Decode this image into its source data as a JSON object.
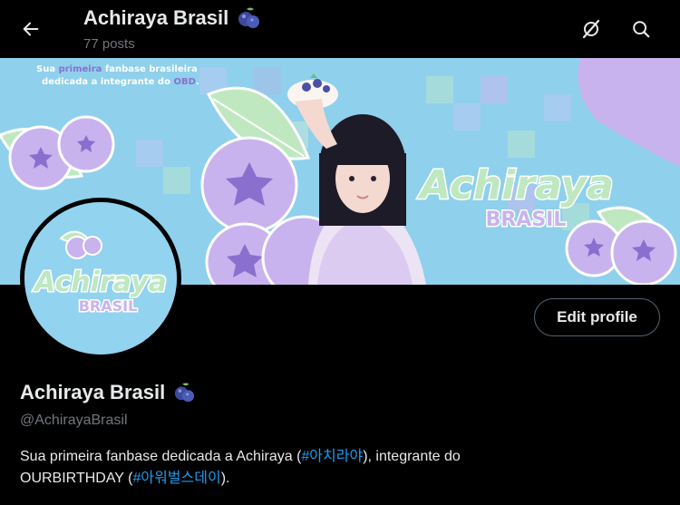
{
  "header": {
    "title": "Achiraya Brasil",
    "posts_count": "77 posts",
    "icons": [
      "arrow-left-icon",
      "grok-icon",
      "search-icon"
    ]
  },
  "banner": {
    "tagline_line1_pre": "Sua ",
    "tagline_line1_highlight": "primeira",
    "tagline_line1_post": " fanbase brasileira",
    "tagline_line2_pre": "dedicada a integrante do ",
    "tagline_line2_highlight": "OBD",
    "tagline_line2_post": ".",
    "logo_script": "Achiraya",
    "logo_sub": "BRASIL"
  },
  "avatar": {
    "logo_script": "Achiraya",
    "logo_sub": "BRASIL"
  },
  "profile": {
    "display_name": "Achiraya Brasil",
    "handle": "@AchirayaBrasil",
    "edit_label": "Edit profile",
    "bio_part1": "Sua primeira fanbase dedicada a Achiraya (",
    "bio_tag1": "#아치라야",
    "bio_part2": "), integrante do",
    "bio_part3": "OURBIRTHDAY (",
    "bio_tag2": "#아워벌스데이",
    "bio_part4": ")."
  },
  "colors": {
    "background": "#000000",
    "text_primary": "#e7e9ea",
    "text_secondary": "#71767b",
    "link": "#1d9bf0",
    "banner_sky": "#8fd0ec",
    "blueberry": "#c8b3ee",
    "leaf": "#bfe8c0"
  }
}
